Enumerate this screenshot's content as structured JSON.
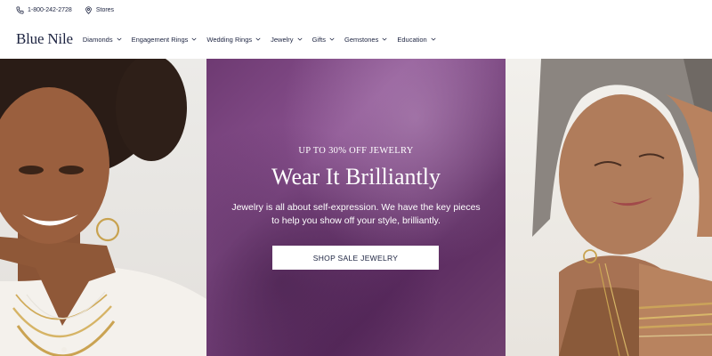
{
  "utility": {
    "phone": "1-800-242-2728",
    "stores": "Stores"
  },
  "nav": {
    "logo": "Blue Nile",
    "items": [
      {
        "label": "Diamonds"
      },
      {
        "label": "Engagement Rings"
      },
      {
        "label": "Wedding Rings"
      },
      {
        "label": "Jewelry"
      },
      {
        "label": "Gifts"
      },
      {
        "label": "Gemstones"
      },
      {
        "label": "Education"
      }
    ]
  },
  "hero": {
    "eyebrow": "UP TO 30% OFF JEWELRY",
    "headline": "Wear It Brilliantly",
    "body_line1": "Jewelry is all about self-expression. We have the key pieces",
    "body_line2": "to help you show off your style, brilliantly.",
    "cta_label": "SHOP SALE JEWELRY"
  },
  "colors": {
    "brand_navy": "#1c2340",
    "hero_purple": "#7a4680",
    "cta_bg": "#ffffff"
  },
  "icons": {
    "phone": "phone-icon",
    "stores": "location-pin-icon",
    "chevron": "chevron-down-icon"
  }
}
